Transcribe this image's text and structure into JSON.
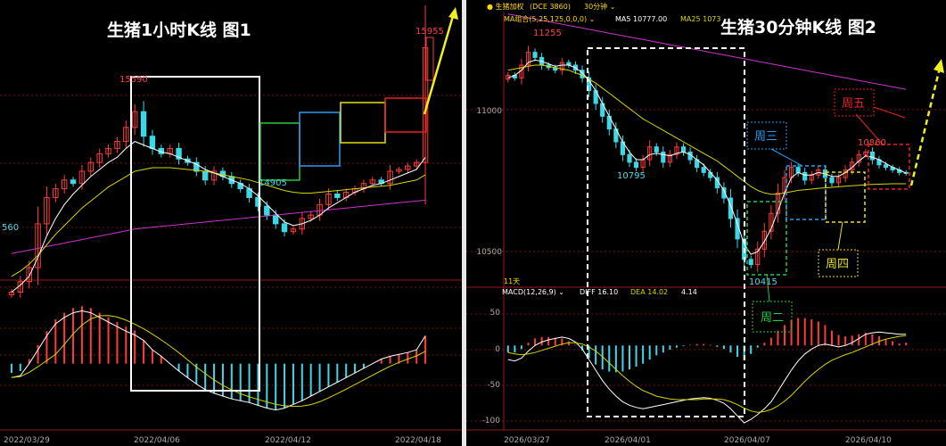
{
  "left_panel": {
    "title": "生猪1小时K线   图1",
    "price_labels": {
      "high": "15590",
      "low": "14905",
      "start": "560",
      "last": "15955"
    },
    "date_labels": [
      "2022/03/29",
      "2022/04/06",
      "2022/04/12",
      "2022/04/18"
    ]
  },
  "right_panel": {
    "title": "生猪30分钟K线   图2",
    "header": {
      "symbol": "● 生猪加权",
      "code": "(DCE 3860)",
      "period": "30分钟 ⌄",
      "ma_group": "MA组合(5,25,125,0,0,0) ⌄",
      "ma5": "MA5 10777.00",
      "ma25": "MA25 1073"
    },
    "price_labels": {
      "high": "11255",
      "mid": "10795",
      "low": "10415",
      "wk_high": "10860"
    },
    "y_axis": [
      "11000",
      "10500"
    ],
    "macd_header": {
      "label": "MACD(12,26,9) ⌄",
      "diff": "DIFF 16.10",
      "dea": "DEA 14.02",
      "macd": "4.14"
    },
    "macd_axis": [
      "50",
      "0",
      "-50",
      "-100"
    ],
    "days_label": "11天",
    "week_labels": {
      "tue": "周二",
      "wed": "周三",
      "thu": "周四",
      "fri": "周五"
    },
    "date_labels": [
      "2026/03/27",
      "2026/04/01",
      "2026/04/07",
      "2026/04/10"
    ]
  },
  "colors": {
    "up": "#ff3b3b",
    "down": "#3cd8e8",
    "ma_short": "#ffffff",
    "ma_mid": "#d6d600",
    "ma_long": "#cc33cc",
    "title": "#ffffff",
    "price_label": "#ff4040",
    "low_label": "#4adce8",
    "box_white": "#ffffff",
    "box_green": "#22cc44",
    "box_blue": "#2a9cf0",
    "box_yellow": "#e8e020",
    "box_red": "#ee2020",
    "arrow": "#f0f020"
  },
  "chart_data": [
    {
      "type": "candlestick",
      "title": "生猪1小时K线   图1",
      "x": [
        "2022/03/29",
        "2022/04/06",
        "2022/04/12",
        "2022/04/18"
      ],
      "ylim": [
        14700,
        16100
      ],
      "series": [
        {
          "name": "price_close",
          "values": [
            14560,
            14620,
            14700,
            14950,
            15100,
            15150,
            15200,
            15180,
            15250,
            15300,
            15350,
            15380,
            15420,
            15500,
            15590,
            15450,
            15380,
            15350,
            15380,
            15320,
            15300,
            15250,
            15200,
            15250,
            15220,
            15180,
            15150,
            15100,
            15050,
            15000,
            14950,
            14905,
            14920,
            14980,
            15000,
            15060,
            15120,
            15100,
            15130,
            15150,
            15180,
            15200,
            15180,
            15250,
            15260,
            15280,
            15300,
            15955
          ]
        },
        {
          "name": "ma_short",
          "values": [
            14560,
            14600,
            14650,
            14760,
            14880,
            14980,
            15060,
            15120,
            15170,
            15220,
            15260,
            15300,
            15330,
            15380,
            15420,
            15400,
            15380,
            15360,
            15350,
            15330,
            15310,
            15290,
            15260,
            15240,
            15220,
            15200,
            15180,
            15150,
            15110,
            15060,
            15010,
            14960,
            14940,
            14950,
            14970,
            15000,
            15040,
            15070,
            15100,
            15130,
            15150,
            15170,
            15180,
            15200,
            15220,
            15240,
            15260,
            15330
          ]
        },
        {
          "name": "ma_mid",
          "values": [
            14650,
            14680,
            14720,
            14770,
            14830,
            14890,
            14940,
            14990,
            15040,
            15080,
            15120,
            15160,
            15190,
            15220,
            15250,
            15260,
            15270,
            15270,
            15270,
            15265,
            15260,
            15255,
            15250,
            15240,
            15230,
            15220,
            15210,
            15200,
            15185,
            15170,
            15155,
            15140,
            15130,
            15125,
            15125,
            15130,
            15135,
            15140,
            15145,
            15150,
            15155,
            15160,
            15165,
            15170,
            15180,
            15190,
            15200,
            15230
          ]
        },
        {
          "name": "ma_long",
          "values": [
            14780,
            14790,
            14800,
            14810,
            14820,
            14830,
            14840,
            14850,
            14860,
            14870,
            14880,
            14890,
            14900,
            14910,
            14920,
            14925,
            14930,
            14935,
            14940,
            14945,
            14950,
            14955,
            14960,
            14965,
            14970,
            14975,
            14980,
            14985,
            14990,
            14995,
            15000,
            15005,
            15010,
            15015,
            15020,
            15025,
            15030,
            15035,
            15040,
            15045,
            15050,
            15055,
            15060,
            15065,
            15070,
            15075,
            15080,
            15085
          ]
        },
        {
          "name": "macd_hist",
          "values": [
            -10,
            -8,
            5,
            20,
            35,
            48,
            55,
            60,
            62,
            60,
            55,
            50,
            45,
            40,
            36,
            25,
            15,
            8,
            0,
            -8,
            -15,
            -22,
            -28,
            -32,
            -35,
            -38,
            -40,
            -42,
            -45,
            -48,
            -50,
            -48,
            -44,
            -40,
            -35,
            -30,
            -25,
            -20,
            -15,
            -10,
            -5,
            0,
            5,
            8,
            10,
            12,
            15,
            30
          ]
        }
      ]
    },
    {
      "type": "candlestick",
      "title": "生猪30分钟K线   图2",
      "x": [
        "2026/03/27",
        "2026/04/01",
        "2026/04/07",
        "2026/04/10"
      ],
      "ylim": [
        10380,
        11350
      ],
      "series": [
        {
          "name": "price_close",
          "values": [
            11160,
            11150,
            11200,
            11250,
            11230,
            11200,
            11190,
            11180,
            11210,
            11200,
            11180,
            11150,
            11100,
            11050,
            11000,
            10950,
            10900,
            10850,
            10820,
            10800,
            10830,
            10880,
            10860,
            10820,
            10850,
            10880,
            10860,
            10830,
            10800,
            10780,
            10760,
            10720,
            10680,
            10600,
            10520,
            10440,
            10420,
            10480,
            10550,
            10620,
            10700,
            10760,
            10800,
            10780,
            10750,
            10770,
            10790,
            10760,
            10740,
            10760,
            10790,
            10820,
            10850,
            10860,
            10830,
            10810,
            10800,
            10790,
            10780,
            10777
          ]
        },
        {
          "name": "ma_short",
          "values": [
            11150,
            11160,
            11180,
            11210,
            11220,
            11215,
            11205,
            11195,
            11200,
            11200,
            11190,
            11170,
            11140,
            11100,
            11050,
            11000,
            10950,
            10900,
            10860,
            10830,
            10830,
            10850,
            10855,
            10850,
            10845,
            10855,
            10860,
            10850,
            10830,
            10810,
            10780,
            10750,
            10710,
            10650,
            10580,
            10500,
            10460,
            10470,
            10510,
            10560,
            10630,
            10700,
            10760,
            10780,
            10770,
            10770,
            10780,
            10775,
            10765,
            10765,
            10780,
            10800,
            10825,
            10845,
            10840,
            10830,
            10815,
            10800,
            10790,
            10777
          ]
        },
        {
          "name": "ma_mid",
          "values": [
            11180,
            11185,
            11190,
            11195,
            11200,
            11200,
            11195,
            11190,
            11185,
            11180,
            11170,
            11160,
            11145,
            11130,
            11110,
            11090,
            11070,
            11050,
            11030,
            11010,
            10990,
            10975,
            10960,
            10945,
            10930,
            10915,
            10900,
            10885,
            10870,
            10855,
            10840,
            10825,
            10805,
            10785,
            10765,
            10745,
            10725,
            10710,
            10700,
            10695,
            10695,
            10700,
            10705,
            10710,
            10712,
            10715,
            10718,
            10720,
            10722,
            10724,
            10726,
            10728,
            10730,
            10732,
            10733,
            10734,
            10735,
            10736,
            10736,
            10736
          ]
        },
        {
          "name": "ma_long",
          "values": [
            11400,
            11395,
            11390,
            11385,
            11380,
            11375,
            11370,
            11365,
            11360,
            11355,
            11350,
            11345,
            11340,
            11335,
            11330,
            11325,
            11320,
            11315,
            11310,
            11305,
            11300,
            11295,
            11290,
            11285,
            11280,
            11275,
            11270,
            11265,
            11260,
            11255,
            11250,
            11245,
            11240,
            11235,
            11230,
            11225,
            11220,
            11215,
            11210,
            11205,
            11200,
            11195,
            11190,
            11185,
            11180,
            11175,
            11170,
            11165,
            11160,
            11155,
            11150,
            11145,
            11140,
            11135,
            11130,
            11125,
            11120,
            11115,
            11110,
            11105
          ]
        },
        {
          "name": "macd_diff",
          "values": [
            -20,
            -22,
            -18,
            -8,
            0,
            5,
            8,
            10,
            12,
            10,
            5,
            -5,
            -20,
            -35,
            -50,
            -62,
            -72,
            -80,
            -85,
            -88,
            -90,
            -88,
            -86,
            -84,
            -82,
            -80,
            -78,
            -76,
            -75,
            -74,
            -75,
            -78,
            -82,
            -90,
            -100,
            -110,
            -105,
            -98,
            -90,
            -80,
            -65,
            -50,
            -35,
            -22,
            -12,
            -5,
            0,
            2,
            0,
            -2,
            0,
            4,
            10,
            16,
            18,
            19,
            18,
            17,
            16,
            16.1
          ]
        },
        {
          "name": "macd_dea",
          "values": [
            -10,
            -12,
            -13,
            -12,
            -10,
            -7,
            -4,
            -1,
            2,
            4,
            4,
            2,
            -2,
            -8,
            -16,
            -25,
            -34,
            -43,
            -51,
            -58,
            -64,
            -68,
            -72,
            -74,
            -76,
            -77,
            -77,
            -77,
            -77,
            -76,
            -76,
            -76,
            -77,
            -80,
            -84,
            -89,
            -93,
            -95,
            -94,
            -91,
            -86,
            -79,
            -71,
            -61,
            -51,
            -42,
            -34,
            -27,
            -21,
            -17,
            -13,
            -10,
            -6,
            -2,
            2,
            6,
            9,
            11,
            13,
            14.02
          ]
        },
        {
          "name": "macd_hist",
          "values": [
            -10,
            -10,
            -5,
            4,
            10,
            12,
            12,
            11,
            10,
            6,
            1,
            -7,
            -18,
            -27,
            -34,
            -37,
            -38,
            -37,
            -34,
            -30,
            -26,
            -20,
            -14,
            -10,
            -6,
            -3,
            -1,
            1,
            2,
            2,
            1,
            -2,
            -5,
            -10,
            -16,
            -21,
            -12,
            -3,
            4,
            11,
            21,
            29,
            36,
            39,
            39,
            37,
            34,
            29,
            21,
            15,
            13,
            14,
            16,
            18,
            16,
            13,
            9,
            6,
            3,
            4.14
          ]
        }
      ]
    }
  ]
}
